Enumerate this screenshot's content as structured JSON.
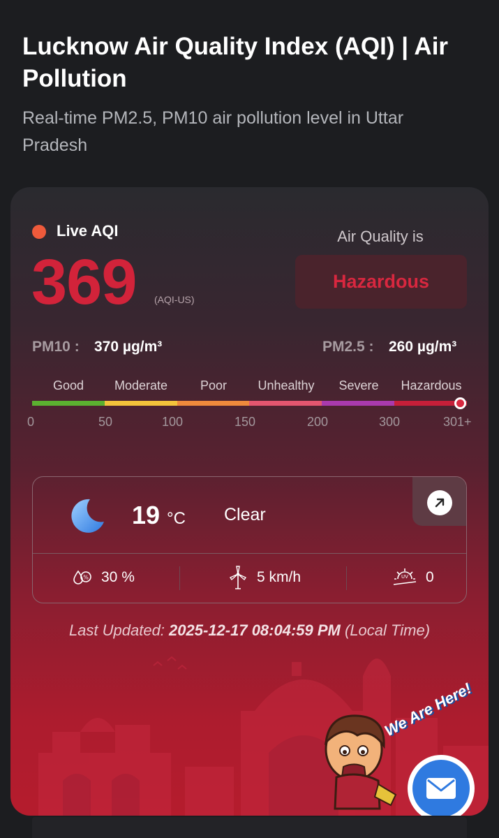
{
  "header": {
    "title": "Lucknow Air Quality Index (AQI) | Air Pollution",
    "subtitle": "Real-time PM2.5, PM10 air pollution level in Uttar Pradesh"
  },
  "aqi": {
    "live_label": "Live AQI",
    "value": "369",
    "unit": "(AQI-US)",
    "status_heading": "Air Quality is",
    "status": "Hazardous",
    "status_color": "#d8273f"
  },
  "pollutants": {
    "pm10_label": "PM10 :",
    "pm10_value": "370 µg/m³",
    "pm25_label": "PM2.5 :",
    "pm25_value": "260 µg/m³"
  },
  "scale": {
    "categories": [
      {
        "label": "Good",
        "color": "#5bb030"
      },
      {
        "label": "Moderate",
        "color": "#f3c33b"
      },
      {
        "label": "Poor",
        "color": "#ee8a3c"
      },
      {
        "label": "Unhealthy",
        "color": "#e2566f"
      },
      {
        "label": "Severe",
        "color": "#a93aad"
      },
      {
        "label": "Hazardous",
        "color": "#c61f39"
      }
    ],
    "ticks": [
      "0",
      "50",
      "100",
      "150",
      "200",
      "300",
      "301+"
    ]
  },
  "weather": {
    "icon": "crescent-moon-icon",
    "temperature": "19",
    "temperature_unit": "°C",
    "condition": "Clear",
    "humidity": "30 %",
    "wind": "5 km/h",
    "uv_index": "0"
  },
  "last_updated": {
    "label": "Last Updated:",
    "timestamp": "2025-12-17 08:04:59 PM",
    "suffix": "(Local Time)"
  },
  "promo": {
    "badge_text": "We Are Here!"
  }
}
